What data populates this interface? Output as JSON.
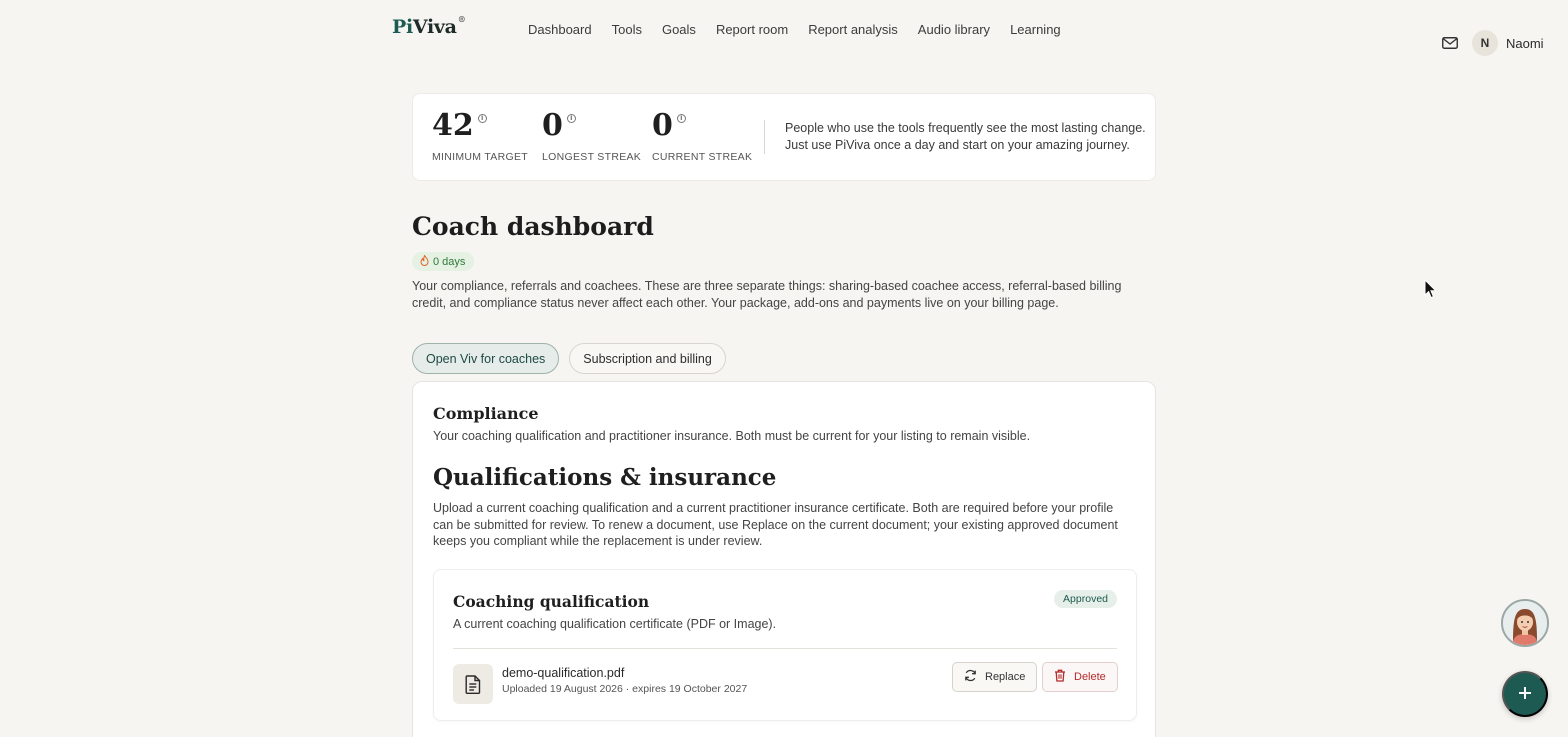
{
  "brand": {
    "logo_text_accent": "Pi",
    "logo_text_rest": "Viva",
    "logo_mark": "®"
  },
  "nav": {
    "items": [
      "Dashboard",
      "Tools",
      "Goals",
      "Report room",
      "Report analysis",
      "Audio library",
      "Learning"
    ]
  },
  "user": {
    "initial": "N",
    "name": "Naomi",
    "mail_icon": "mail-icon"
  },
  "stats": {
    "items": [
      {
        "value": "42",
        "label": "MINIMUM TARGET"
      },
      {
        "value": "0",
        "label": "LONGEST STREAK"
      },
      {
        "value": "0",
        "label": "CURRENT STREAK"
      }
    ],
    "message_line1": "People who use the tools frequently see the most lasting change.",
    "message_line2": "Just use PiViva once a day and start on your amazing journey."
  },
  "page": {
    "title": "Coach dashboard",
    "streak_badge": "0 days",
    "intro": "Your compliance, referrals and coachees. These are three separate things: sharing-based coachee access, referral-based billing credit, and compliance status never affect each other. Your package, add-ons and payments live on your billing page."
  },
  "tabs": {
    "open_viv": "Open Viv for coaches",
    "billing": "Subscription and billing"
  },
  "compliance": {
    "title": "Compliance",
    "description": "Your coaching qualification and practitioner insurance. Both must be current for your listing to remain visible.",
    "section_title": "Qualifications & insurance",
    "section_description": "Upload a current coaching qualification and a current practitioner insurance certificate. Both are required before your profile can be submitted for review. To renew a document, use Replace on the current document; your existing approved document keeps you compliant while the replacement is under review."
  },
  "qualification": {
    "title": "Coaching qualification",
    "status": "Approved",
    "description": "A current coaching qualification certificate (PDF or Image).",
    "file_name": "demo-qualification.pdf",
    "file_meta": "Uploaded 19 August 2026 · expires 19 October 2027",
    "replace_label": "Replace",
    "delete_label": "Delete"
  },
  "colors": {
    "brand": "#1d5a52",
    "approved_bg": "#e6efea",
    "streak_bg": "#e5f1e3",
    "delete": "#b42b2b"
  }
}
